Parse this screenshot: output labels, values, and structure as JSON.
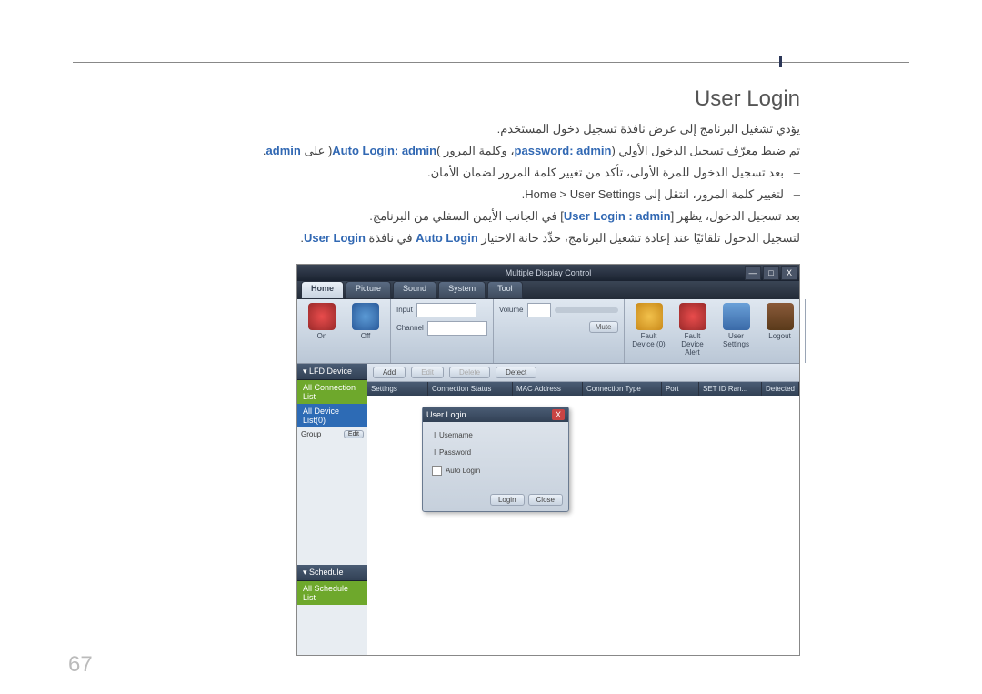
{
  "page_number": "67",
  "heading": "User Login",
  "lines": {
    "l1_a": "يؤدي تشغيل البرنامج إلى عرض نافذة تسجيل دخول المستخدم.",
    "l2_a": "تم ضبط معرّف تسجيل الدخول الأولي (",
    "l2_b": "password: admin",
    "l2_c": "، وكلمة المرور )",
    "l2_d": "Auto Login: admin",
    "l2_e": "( على ",
    "l2_f": "admin",
    "l2_g": ".",
    "b1": "بعد تسجيل الدخول للمرة الأولى، تأكد من تغيير كلمة المرور لضمان الأمان.",
    "b2_a": "لتغيير كلمة المرور، انتقل إلى ",
    "b2_b": "Home > User Settings",
    "b2_c": ".",
    "l4_a": "بعد تسجيل الدخول، يظهر [",
    "l4_b": "User Login : admin",
    "l4_c": "] في الجانب الأيمن السفلي من البرنامج.",
    "l5_a": "لتسجيل الدخول تلقائيًا عند إعادة تشغيل البرنامج، حدِّد خانة الاختيار ",
    "l5_b": "Auto Login",
    "l5_c": " في نافذة ",
    "l5_d": "User Login",
    "l5_e": "."
  },
  "app": {
    "title": "Multiple Display Control",
    "tabs": [
      "Home",
      "Picture",
      "Sound",
      "System",
      "Tool"
    ],
    "ribbon": {
      "on": "On",
      "off": "Off",
      "input": "Input",
      "channel": "Channel",
      "volume": "Volume",
      "mute": "Mute",
      "fault_device": "Fault Device (0)",
      "fault_alert": "Fault Device Alert",
      "user_settings": "User Settings",
      "logout": "Logout"
    },
    "sidebar": {
      "lfd": "▾ LFD Device",
      "all_conn": "All Connection List",
      "all_dev": "All Device List(0)",
      "group": "Group",
      "edit": "Edit",
      "schedule": "▾ Schedule",
      "all_sched": "All Schedule List"
    },
    "toolbar": {
      "add": "Add",
      "edit": "Edit",
      "delete": "Delete",
      "detect": "Detect"
    },
    "cols": [
      "Settings",
      "Connection Status",
      "MAC Address",
      "Connection Type",
      "Port",
      "SET ID Ran...",
      "Detected"
    ],
    "dialog": {
      "title": "User Login",
      "username": "Username",
      "password": "Password",
      "auto": "Auto Login",
      "login": "Login",
      "close": "Close"
    },
    "win": {
      "min": "—",
      "max": "□",
      "close": "X"
    }
  }
}
